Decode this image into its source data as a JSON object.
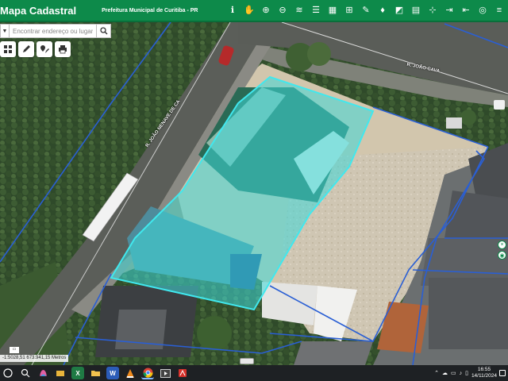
{
  "header": {
    "title": "Mapa Cadastral",
    "subtitle": "Prefeitura Municipal de Curitiba - PR",
    "bg_color": "#0d8a4a",
    "tools": [
      {
        "icon": "identify-icon",
        "glyph": "ℹ"
      },
      {
        "icon": "pan-hand-icon",
        "glyph": "✋"
      },
      {
        "icon": "zoom-in-icon",
        "glyph": "⊕"
      },
      {
        "icon": "zoom-out-icon",
        "glyph": "⊖"
      },
      {
        "icon": "layers-icon",
        "glyph": "≋"
      },
      {
        "icon": "legend-list-icon",
        "glyph": "☰"
      },
      {
        "icon": "table-icon",
        "glyph": "▦"
      },
      {
        "icon": "measure-icon",
        "glyph": "⊞"
      },
      {
        "icon": "draw-icon",
        "glyph": "✎"
      },
      {
        "icon": "graduation-icon",
        "glyph": "♦"
      },
      {
        "icon": "edit-area-icon",
        "glyph": "◩"
      },
      {
        "icon": "chart-icon",
        "glyph": "▤"
      },
      {
        "icon": "coordinates-icon",
        "glyph": "⊹"
      },
      {
        "icon": "import-icon",
        "glyph": "⇥"
      },
      {
        "icon": "logout-icon",
        "glyph": "⇤"
      },
      {
        "icon": "location-icon",
        "glyph": "◎"
      },
      {
        "icon": "menu-icon",
        "glyph": "≡"
      }
    ]
  },
  "search": {
    "placeholder": "Encontrar endereço ou lugar",
    "value": ""
  },
  "side_tools": [
    "layers-grid-icon",
    "pencil-icon",
    "pin-edit-icon",
    "print-icon"
  ],
  "streets": {
    "street_1": "R. JOÃO CAVA",
    "street_2": "R. JOÃO NENAVE DE CA"
  },
  "coordinates": "-1:5028,51 673.941,15 Metros",
  "colors": {
    "parcel_fill": "#3ed8d8",
    "parcel_stroke": "#40e8ee",
    "lot_lines": "#2a5fd4",
    "road": "#5a5d58"
  },
  "taskbar": {
    "time": "16:55",
    "date": "14/11/2024",
    "apps": [
      "start-icon",
      "search-taskbar-icon",
      "copilot-icon",
      "file-explorer-icon",
      "excel-icon",
      "folder-icon",
      "word-icon",
      "vlc-icon",
      "chrome-icon",
      "media-icon",
      "pdf-icon"
    ]
  }
}
